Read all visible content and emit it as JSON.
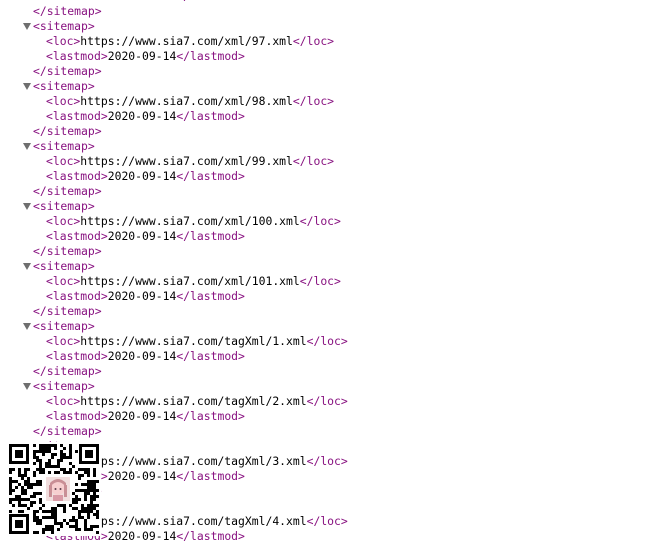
{
  "lines": [
    {
      "kind": "text",
      "depth": 1,
      "tag": "lastmod",
      "text": "2020-09-14"
    },
    {
      "kind": "close",
      "depth": 0,
      "tag": "sitemap"
    },
    {
      "kind": "open",
      "depth": 0,
      "tag": "sitemap"
    },
    {
      "kind": "text",
      "depth": 1,
      "tag": "loc",
      "text": "https://www.sia7.com/xml/97.xml"
    },
    {
      "kind": "text",
      "depth": 1,
      "tag": "lastmod",
      "text": "2020-09-14"
    },
    {
      "kind": "close",
      "depth": 0,
      "tag": "sitemap"
    },
    {
      "kind": "open",
      "depth": 0,
      "tag": "sitemap"
    },
    {
      "kind": "text",
      "depth": 1,
      "tag": "loc",
      "text": "https://www.sia7.com/xml/98.xml"
    },
    {
      "kind": "text",
      "depth": 1,
      "tag": "lastmod",
      "text": "2020-09-14"
    },
    {
      "kind": "close",
      "depth": 0,
      "tag": "sitemap"
    },
    {
      "kind": "open",
      "depth": 0,
      "tag": "sitemap"
    },
    {
      "kind": "text",
      "depth": 1,
      "tag": "loc",
      "text": "https://www.sia7.com/xml/99.xml"
    },
    {
      "kind": "text",
      "depth": 1,
      "tag": "lastmod",
      "text": "2020-09-14"
    },
    {
      "kind": "close",
      "depth": 0,
      "tag": "sitemap"
    },
    {
      "kind": "open",
      "depth": 0,
      "tag": "sitemap"
    },
    {
      "kind": "text",
      "depth": 1,
      "tag": "loc",
      "text": "https://www.sia7.com/xml/100.xml"
    },
    {
      "kind": "text",
      "depth": 1,
      "tag": "lastmod",
      "text": "2020-09-14"
    },
    {
      "kind": "close",
      "depth": 0,
      "tag": "sitemap"
    },
    {
      "kind": "open",
      "depth": 0,
      "tag": "sitemap"
    },
    {
      "kind": "text",
      "depth": 1,
      "tag": "loc",
      "text": "https://www.sia7.com/xml/101.xml"
    },
    {
      "kind": "text",
      "depth": 1,
      "tag": "lastmod",
      "text": "2020-09-14"
    },
    {
      "kind": "close",
      "depth": 0,
      "tag": "sitemap"
    },
    {
      "kind": "open",
      "depth": 0,
      "tag": "sitemap"
    },
    {
      "kind": "text",
      "depth": 1,
      "tag": "loc",
      "text": "https://www.sia7.com/tagXml/1.xml"
    },
    {
      "kind": "text",
      "depth": 1,
      "tag": "lastmod",
      "text": "2020-09-14"
    },
    {
      "kind": "close",
      "depth": 0,
      "tag": "sitemap"
    },
    {
      "kind": "open",
      "depth": 0,
      "tag": "sitemap"
    },
    {
      "kind": "text",
      "depth": 1,
      "tag": "loc",
      "text": "https://www.sia7.com/tagXml/2.xml"
    },
    {
      "kind": "text",
      "depth": 1,
      "tag": "lastmod",
      "text": "2020-09-14"
    },
    {
      "kind": "close",
      "depth": 0,
      "tag": "sitemap"
    },
    {
      "kind": "open",
      "depth": 0,
      "tag": "sitemap"
    },
    {
      "kind": "text",
      "depth": 1,
      "tag": "loc",
      "text": "https://www.sia7.com/tagXml/3.xml"
    },
    {
      "kind": "text",
      "depth": 1,
      "tag": "lastmod",
      "text": "2020-09-14"
    },
    {
      "kind": "close",
      "depth": 0,
      "tag": "sitemap"
    },
    {
      "kind": "open",
      "depth": 0,
      "tag": "sitemap"
    },
    {
      "kind": "text",
      "depth": 1,
      "tag": "loc",
      "text": "https://www.sia7.com/tagXml/4.xml"
    },
    {
      "kind": "text",
      "depth": 1,
      "tag": "lastmod",
      "text": "2020-09-14"
    }
  ],
  "overlay": {
    "icon": "qr-code-icon",
    "avatar_icon": "avatar-icon"
  },
  "colors": {
    "tag": "#881280",
    "text": "#000000",
    "toggle": "#6e6e6e",
    "background": "#ffffff"
  }
}
